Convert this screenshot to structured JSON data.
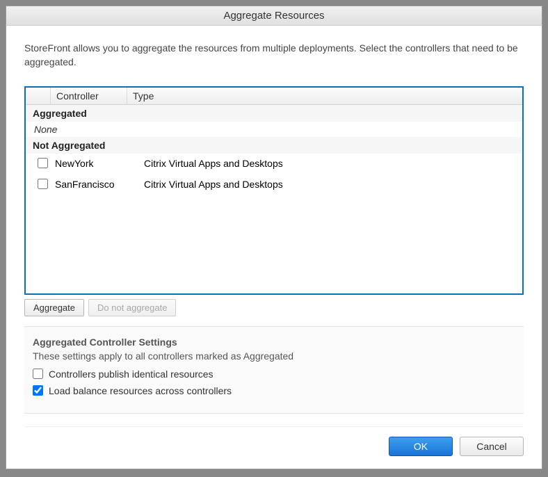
{
  "dialog": {
    "title": "Aggregate Resources",
    "intro": "StoreFront allows you to aggregate the resources from multiple deployments. Select the controllers that need to be aggregated."
  },
  "table": {
    "headers": {
      "controller": "Controller",
      "type": "Type"
    },
    "groups": {
      "aggregated_label": "Aggregated",
      "aggregated_none": "None",
      "not_aggregated_label": "Not Aggregated"
    },
    "rows": [
      {
        "controller": "NewYork",
        "type": "Citrix Virtual Apps and Desktops",
        "checked": false
      },
      {
        "controller": "SanFrancisco",
        "type": "Citrix Virtual Apps and Desktops",
        "checked": false
      }
    ]
  },
  "actions": {
    "aggregate": "Aggregate",
    "do_not_aggregate": "Do not aggregate"
  },
  "settings": {
    "title": "Aggregated Controller Settings",
    "subtitle": "These settings apply to all controllers marked as Aggregated",
    "opt_publish_identical": "Controllers publish identical resources",
    "opt_publish_identical_checked": false,
    "opt_load_balance": "Load balance resources across controllers",
    "opt_load_balance_checked": true
  },
  "footer": {
    "ok": "OK",
    "cancel": "Cancel"
  }
}
